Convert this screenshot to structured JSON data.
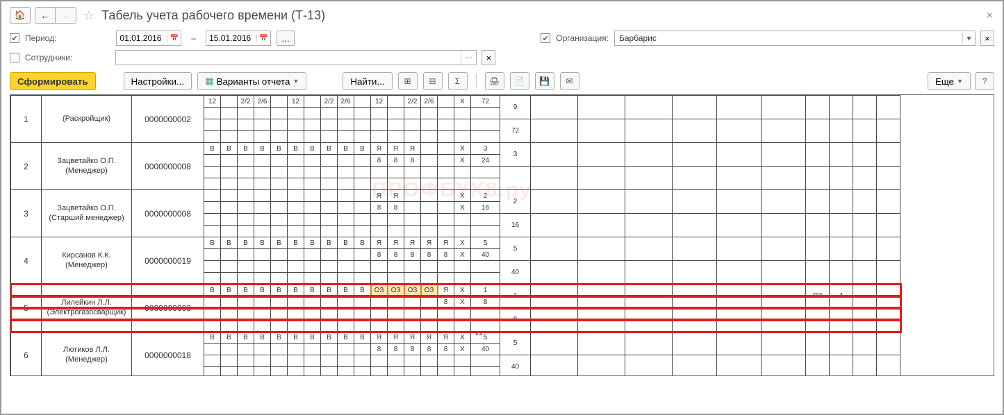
{
  "title": "Табель учета рабочего времени (Т-13)",
  "filters": {
    "period_label": "Период:",
    "date_from": "01.01.2016",
    "date_to": "15.01.2016",
    "org_label": "Организация:",
    "org_value": "Барбарис",
    "employees_label": "Сотрудники:",
    "employees_value": ""
  },
  "toolbar": {
    "generate": "Сформировать",
    "settings": "Настройки...",
    "variants": "Варианты отчета",
    "find": "Найти...",
    "more": "Еще"
  },
  "rows": [
    {
      "num": "1",
      "name": "(Раскройщик)",
      "tab": "0000000002",
      "r1": [
        "12",
        "",
        "2/2",
        "2/6",
        "",
        "12",
        "",
        "2/2",
        "2/6",
        "",
        "12",
        "",
        "2/2",
        "2/6",
        "",
        "Х"
      ],
      "r2": [
        "",
        "",
        "",
        "",
        "",
        "",
        "",
        "",
        "",
        "",
        "",
        "",
        "",
        "",
        "",
        ""
      ],
      "sr1": "72",
      "sr2": "",
      "blk1": "9",
      "blk2": "72",
      "extra": []
    },
    {
      "num": "2",
      "name": "Зацветайко О.П.\n(Менеджер)",
      "tab": "0000000008",
      "r1": [
        "В",
        "В",
        "В",
        "В",
        "В",
        "В",
        "В",
        "В",
        "В",
        "В",
        "Я",
        "Я",
        "Я",
        "",
        "",
        "Х"
      ],
      "r2": [
        "",
        "",
        "",
        "",
        "",
        "",
        "",
        "",
        "",
        "",
        "8",
        "8",
        "8",
        "",
        "",
        "Х"
      ],
      "sr1": "3",
      "sr2": "24",
      "blk1": "3",
      "blk2": "",
      "extra": []
    },
    {
      "num": "3",
      "name": "Зацветайко О.П.\n(Старший менеджер)",
      "tab": "0000000008",
      "r1": [
        "",
        "",
        "",
        "",
        "",
        "",
        "",
        "",
        "",
        "",
        "Я",
        "Я",
        "",
        "",
        "",
        "Х"
      ],
      "r2": [
        "",
        "",
        "",
        "",
        "",
        "",
        "",
        "",
        "",
        "",
        "8",
        "8",
        "",
        "",
        "",
        "Х"
      ],
      "sr1": "2",
      "sr2": "16",
      "blk1": "2",
      "blk2": "16",
      "extra": []
    },
    {
      "num": "4",
      "name": "Кирсанов К.К.\n(Менеджер)",
      "tab": "0000000019",
      "r1": [
        "В",
        "В",
        "В",
        "В",
        "В",
        "В",
        "В",
        "В",
        "В",
        "В",
        "Я",
        "Я",
        "Я",
        "Я",
        "Я",
        "Х"
      ],
      "r2": [
        "",
        "",
        "",
        "",
        "",
        "",
        "",
        "",
        "",
        "",
        "8",
        "8",
        "8",
        "8",
        "8",
        "Х"
      ],
      "sr1": "5",
      "sr2": "40",
      "blk1": "5",
      "blk2": "40",
      "extra": []
    },
    {
      "num": "5",
      "name": "Лилейкин Л.Л.\n(Электрогазосварщик)",
      "tab": "0000000003",
      "r1": [
        "В",
        "В",
        "В",
        "В",
        "В",
        "В",
        "В",
        "В",
        "В",
        "В",
        "ОЗ",
        "ОЗ",
        "ОЗ",
        "ОЗ",
        "Я",
        "Х"
      ],
      "r2": [
        "",
        "",
        "",
        "",
        "",
        "",
        "",
        "",
        "",
        "",
        "",
        "",
        "",
        "",
        "8",
        "Х"
      ],
      "sr1": "1",
      "sr2": "8",
      "blk1": "1",
      "blk2": "8",
      "highlight": true,
      "extra": [
        "ОЗ",
        "4"
      ]
    },
    {
      "num": "6",
      "name": "Лютиков Л.Л.\n(Менеджер)",
      "tab": "0000000018",
      "r1": [
        "В",
        "В",
        "В",
        "В",
        "В",
        "В",
        "В",
        "В",
        "В",
        "В",
        "Я",
        "Я",
        "Я",
        "Я",
        "Я",
        "Х"
      ],
      "r2": [
        "",
        "",
        "",
        "",
        "",
        "",
        "",
        "",
        "",
        "",
        "8",
        "8",
        "8",
        "8",
        "8",
        "Х"
      ],
      "sr1": "5",
      "sr2": "40",
      "blk1": "5",
      "blk2": "40",
      "extra": []
    }
  ],
  "watermark": "ПРОФБУХ8.ру"
}
